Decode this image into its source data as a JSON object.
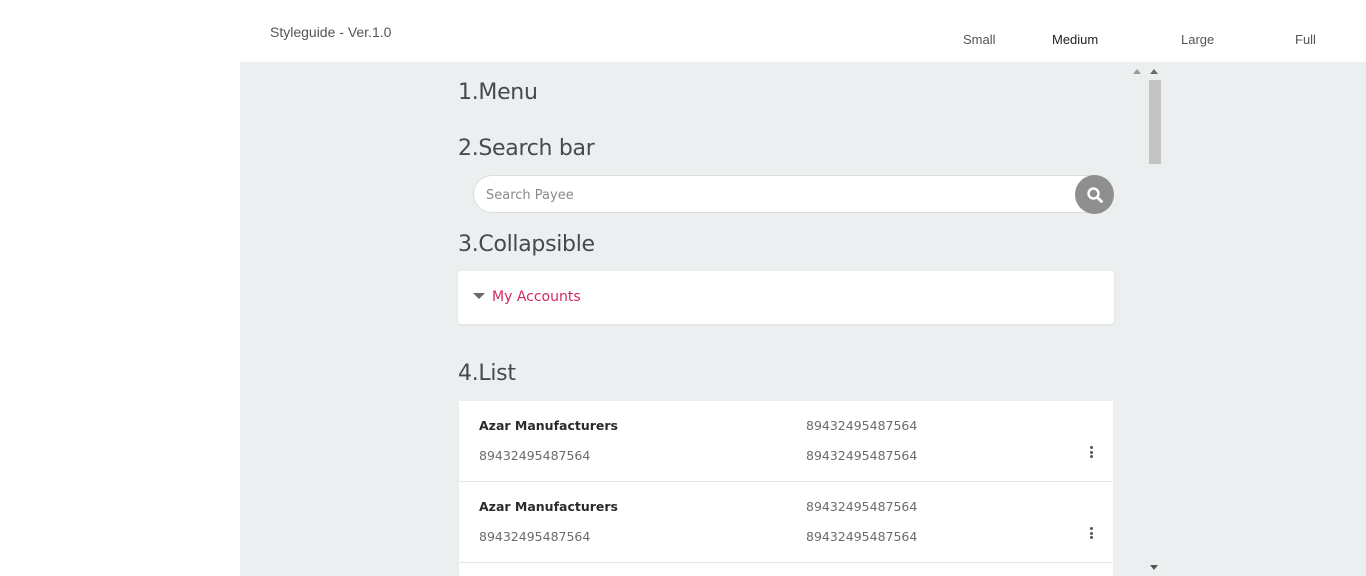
{
  "header": {
    "title": "Styleguide - Ver.1.0",
    "size_tabs": [
      {
        "label": "Small"
      },
      {
        "label": "Medium"
      },
      {
        "label": "Large"
      },
      {
        "label": "Full"
      }
    ],
    "active_tab": "Medium"
  },
  "sections": {
    "menu": "1.Menu",
    "search": "2.Search bar",
    "collapsible": "3.Collapsible",
    "list": "4.List"
  },
  "search": {
    "placeholder": "Search Payee",
    "value": "",
    "button_icon": "search-icon"
  },
  "collapsible": {
    "label": "My Accounts",
    "icon": "caret-down-icon"
  },
  "list": {
    "rows": [
      {
        "name": "Azar Manufacturers",
        "sub": "89432495487564",
        "right_top": "89432495487564",
        "right_bottom": "89432495487564",
        "menu_icon": "more-vertical-icon"
      },
      {
        "name": "Azar Manufacturers",
        "sub": "89432495487564",
        "right_top": "89432495487564",
        "right_bottom": "89432495487564",
        "menu_icon": "more-vertical-icon"
      }
    ]
  },
  "colors": {
    "accent": "#d12a5c",
    "stage_background": "#eceff0",
    "search_button": "#8f8f8f"
  }
}
